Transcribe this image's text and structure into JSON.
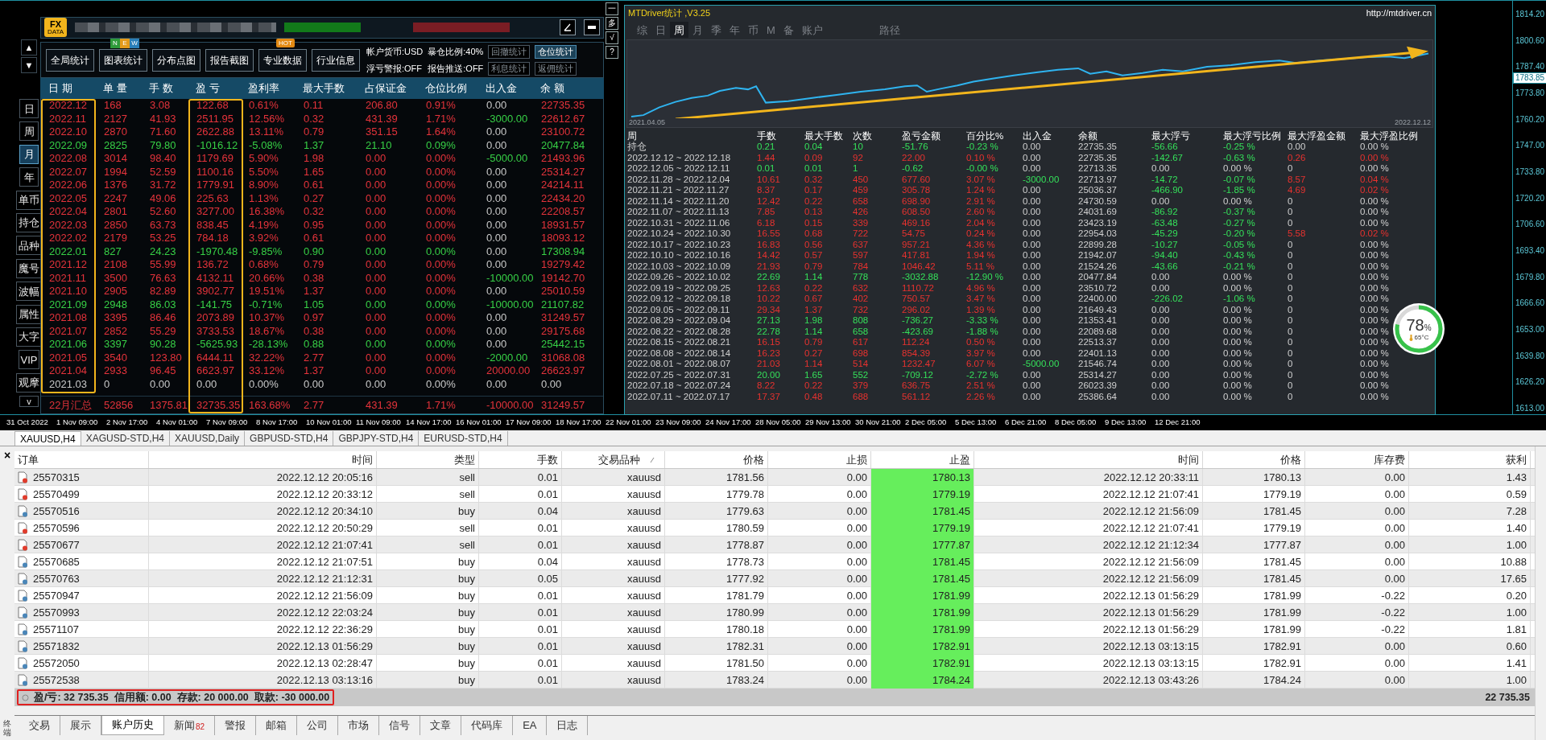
{
  "left_panel": {
    "logo": {
      "top": "FX",
      "bottom": "DATA"
    },
    "nav_arrows": [
      "▲",
      "▼"
    ],
    "side_buttons": [
      {
        "label": "日",
        "selected": false
      },
      {
        "label": "周",
        "selected": false
      },
      {
        "label": "月",
        "selected": true
      },
      {
        "label": "年",
        "selected": false
      },
      {
        "label": "单币",
        "selected": false
      },
      {
        "label": "持仓",
        "selected": false
      },
      {
        "label": "品种",
        "selected": false
      },
      {
        "label": "魔号",
        "selected": false
      },
      {
        "label": "波幅",
        "selected": false
      },
      {
        "label": "属性",
        "selected": false
      },
      {
        "label": "大字",
        "selected": false
      },
      {
        "label": "VIP",
        "selected": false
      },
      {
        "label": "观摩",
        "selected": false
      },
      {
        "label": "v",
        "selected": false
      }
    ],
    "toolbar": [
      {
        "label": "全局统计"
      },
      {
        "label": "图表统计",
        "badge": {
          "kind": "new",
          "letters": [
            "N",
            "E",
            "W"
          ]
        }
      },
      {
        "label": "分布点图"
      },
      {
        "label": "报告截图"
      },
      {
        "label": "专业数据",
        "badge": {
          "kind": "hot",
          "letters": [
            "HOT"
          ]
        }
      },
      {
        "label": "行业信息"
      }
    ],
    "info": [
      "帐户货币:USD",
      "暴仓比例:40%",
      "浮亏警报:OFF",
      "报告推送:OFF"
    ],
    "stat_buttons": [
      {
        "label": "回撤统计",
        "selected": false
      },
      {
        "label": "仓位统计",
        "selected": true
      },
      {
        "label": "利息统计",
        "selected": false
      },
      {
        "label": "返佣统计",
        "selected": false
      }
    ],
    "columns": [
      "日 期",
      "单 量",
      "手 数",
      "盈 亏",
      "盈利率",
      "最大手数",
      "占保证金",
      "仓位比例",
      "出入金",
      "余 额"
    ],
    "rows": [
      {
        "kind": "gain",
        "withdrawal": false,
        "deposit": false,
        "cells": [
          "2022.12",
          "168",
          "3.08",
          "122.68",
          "0.61%",
          "0.11",
          "206.80",
          "0.91%",
          "0.00",
          "22735.35"
        ]
      },
      {
        "kind": "gain",
        "withdrawal": true,
        "deposit": false,
        "cells": [
          "2022.11",
          "2127",
          "41.93",
          "2511.95",
          "12.56%",
          "0.32",
          "431.39",
          "1.71%",
          "-3000.00",
          "22612.67"
        ]
      },
      {
        "kind": "gain",
        "withdrawal": false,
        "deposit": false,
        "cells": [
          "2022.10",
          "2870",
          "71.60",
          "2622.88",
          "13.11%",
          "0.79",
          "351.15",
          "1.64%",
          "0.00",
          "23100.72"
        ]
      },
      {
        "kind": "loss",
        "withdrawal": false,
        "deposit": false,
        "cells": [
          "2022.09",
          "2825",
          "79.80",
          "-1016.12",
          "-5.08%",
          "1.37",
          "21.10",
          "0.09%",
          "0.00",
          "20477.84"
        ]
      },
      {
        "kind": "gain",
        "withdrawal": true,
        "deposit": false,
        "cells": [
          "2022.08",
          "3014",
          "98.40",
          "1179.69",
          "5.90%",
          "1.98",
          "0.00",
          "0.00%",
          "-5000.00",
          "21493.96"
        ]
      },
      {
        "kind": "gain",
        "withdrawal": false,
        "deposit": false,
        "cells": [
          "2022.07",
          "1994",
          "52.59",
          "1100.16",
          "5.50%",
          "1.65",
          "0.00",
          "0.00%",
          "0.00",
          "25314.27"
        ]
      },
      {
        "kind": "gain",
        "withdrawal": false,
        "deposit": false,
        "cells": [
          "2022.06",
          "1376",
          "31.72",
          "1779.91",
          "8.90%",
          "0.61",
          "0.00",
          "0.00%",
          "0.00",
          "24214.11"
        ]
      },
      {
        "kind": "gain",
        "withdrawal": false,
        "deposit": false,
        "cells": [
          "2022.05",
          "2247",
          "49.06",
          "225.63",
          "1.13%",
          "0.27",
          "0.00",
          "0.00%",
          "0.00",
          "22434.20"
        ]
      },
      {
        "kind": "gain",
        "withdrawal": false,
        "deposit": false,
        "cells": [
          "2022.04",
          "2801",
          "52.60",
          "3277.00",
          "16.38%",
          "0.32",
          "0.00",
          "0.00%",
          "0.00",
          "22208.57"
        ]
      },
      {
        "kind": "gain",
        "withdrawal": false,
        "deposit": false,
        "cells": [
          "2022.03",
          "2850",
          "63.73",
          "838.45",
          "4.19%",
          "0.95",
          "0.00",
          "0.00%",
          "0.00",
          "18931.57"
        ]
      },
      {
        "kind": "gain",
        "withdrawal": false,
        "deposit": false,
        "cells": [
          "2022.02",
          "2179",
          "53.25",
          "784.18",
          "3.92%",
          "0.61",
          "0.00",
          "0.00%",
          "0.00",
          "18093.12"
        ]
      },
      {
        "kind": "loss",
        "withdrawal": false,
        "deposit": false,
        "cells": [
          "2022.01",
          "827",
          "24.23",
          "-1970.48",
          "-9.85%",
          "0.90",
          "0.00",
          "0.00%",
          "0.00",
          "17308.94"
        ]
      },
      {
        "kind": "gain",
        "withdrawal": false,
        "deposit": false,
        "cells": [
          "2021.12",
          "2108",
          "55.99",
          "136.72",
          "0.68%",
          "0.79",
          "0.00",
          "0.00%",
          "0.00",
          "19279.42"
        ]
      },
      {
        "kind": "gain",
        "withdrawal": true,
        "deposit": false,
        "cells": [
          "2021.11",
          "3500",
          "76.63",
          "4132.11",
          "20.66%",
          "0.38",
          "0.00",
          "0.00%",
          "-10000.00",
          "19142.70"
        ]
      },
      {
        "kind": "gain",
        "withdrawal": false,
        "deposit": false,
        "cells": [
          "2021.10",
          "2905",
          "82.89",
          "3902.77",
          "19.51%",
          "1.37",
          "0.00",
          "0.00%",
          "0.00",
          "25010.59"
        ]
      },
      {
        "kind": "loss",
        "withdrawal": true,
        "deposit": false,
        "cells": [
          "2021.09",
          "2948",
          "86.03",
          "-141.75",
          "-0.71%",
          "1.05",
          "0.00",
          "0.00%",
          "-10000.00",
          "21107.82"
        ]
      },
      {
        "kind": "gain",
        "withdrawal": false,
        "deposit": false,
        "cells": [
          "2021.08",
          "3395",
          "86.46",
          "2073.89",
          "10.37%",
          "0.97",
          "0.00",
          "0.00%",
          "0.00",
          "31249.57"
        ]
      },
      {
        "kind": "gain",
        "withdrawal": false,
        "deposit": false,
        "cells": [
          "2021.07",
          "2852",
          "55.29",
          "3733.53",
          "18.67%",
          "0.38",
          "0.00",
          "0.00%",
          "0.00",
          "29175.68"
        ]
      },
      {
        "kind": "loss",
        "withdrawal": false,
        "deposit": false,
        "cells": [
          "2021.06",
          "3397",
          "90.28",
          "-5625.93",
          "-28.13%",
          "0.88",
          "0.00",
          "0.00%",
          "0.00",
          "25442.15"
        ]
      },
      {
        "kind": "gain",
        "withdrawal": true,
        "deposit": false,
        "cells": [
          "2021.05",
          "3540",
          "123.80",
          "6444.11",
          "32.22%",
          "2.77",
          "0.00",
          "0.00%",
          "-2000.00",
          "31068.08"
        ]
      },
      {
        "kind": "gain",
        "withdrawal": false,
        "deposit": true,
        "cells": [
          "2021.04",
          "2933",
          "96.45",
          "6623.97",
          "33.12%",
          "1.37",
          "0.00",
          "0.00%",
          "20000.00",
          "26623.97"
        ]
      },
      {
        "kind": "flat",
        "withdrawal": false,
        "deposit": false,
        "cells": [
          "2021.03",
          "0",
          "0.00",
          "0.00",
          "0.00%",
          "0.00",
          "0.00",
          "0.00%",
          "0.00",
          "0.00"
        ]
      }
    ],
    "total": [
      "22月汇总",
      "52856",
      "1375.81",
      "32735.35",
      "163.68%",
      "2.77",
      "431.39",
      "1.71%",
      "-10000.00",
      "31249.57"
    ]
  },
  "side_tools": [
    "一",
    "多",
    "√",
    "?"
  ],
  "stats_window": {
    "title": "MTDriver统计 ,V3.25",
    "url": "http://mtdriver.cn",
    "tabs": [
      {
        "label": "综",
        "selected": false
      },
      {
        "label": "日",
        "selected": false
      },
      {
        "label": "周",
        "selected": true
      },
      {
        "label": "月",
        "selected": false
      },
      {
        "label": "季",
        "selected": false
      },
      {
        "label": "年",
        "selected": false
      },
      {
        "label": "币",
        "selected": false
      },
      {
        "label": "M",
        "selected": false
      },
      {
        "label": "备",
        "selected": false
      },
      {
        "label": "账户",
        "selected": false
      }
    ],
    "path_tab": {
      "label": "路径",
      "selected": false
    },
    "chart": {
      "start": "2021.04.05",
      "end": "2022.12.12"
    },
    "columns": [
      "周",
      "手数",
      "最大手数",
      "次数",
      "盈亏金额",
      "百分比%",
      "出入金",
      "余额",
      "最大浮亏",
      "最大浮亏比例",
      "最大浮盈金额",
      "最大浮盈比例"
    ],
    "rows": [
      {
        "kind": "loss",
        "withdrawal": false,
        "drawdown": true,
        "float_gain": false,
        "cells": [
          "持仓",
          "0.21",
          "0.04",
          "10",
          "-51.76",
          "-0.23 %",
          "0.00",
          "22735.35",
          "-56.66",
          "-0.25 %",
          "0.00",
          "0.00 %"
        ]
      },
      {
        "kind": "gain",
        "withdrawal": false,
        "drawdown": true,
        "float_gain": true,
        "cells": [
          "2022.12.12 ~ 2022.12.18",
          "1.44",
          "0.09",
          "92",
          "22.00",
          "0.10 %",
          "0.00",
          "22735.35",
          "-142.67",
          "-0.63 %",
          "0.26",
          "0.00 %"
        ]
      },
      {
        "kind": "loss",
        "withdrawal": false,
        "drawdown": false,
        "float_gain": false,
        "cells": [
          "2022.12.05 ~ 2022.12.11",
          "0.01",
          "0.01",
          "1",
          "-0.62",
          "-0.00 %",
          "0.00",
          "22713.35",
          "0.00",
          "0.00 %",
          "0",
          "0.00 %"
        ]
      },
      {
        "kind": "gain",
        "withdrawal": true,
        "drawdown": true,
        "float_gain": true,
        "cells": [
          "2022.11.28 ~ 2022.12.04",
          "10.61",
          "0.32",
          "450",
          "677.60",
          "3.07 %",
          "-3000.00",
          "22713.97",
          "-14.72",
          "-0.07 %",
          "8.57",
          "0.04 %"
        ]
      },
      {
        "kind": "gain",
        "withdrawal": false,
        "drawdown": true,
        "float_gain": true,
        "cells": [
          "2022.11.21 ~ 2022.11.27",
          "8.37",
          "0.17",
          "459",
          "305.78",
          "1.24 %",
          "0.00",
          "25036.37",
          "-466.90",
          "-1.85 %",
          "4.69",
          "0.02 %"
        ]
      },
      {
        "kind": "gain",
        "withdrawal": false,
        "drawdown": false,
        "float_gain": false,
        "cells": [
          "2022.11.14 ~ 2022.11.20",
          "12.42",
          "0.22",
          "658",
          "698.90",
          "2.91 %",
          "0.00",
          "24730.59",
          "0.00",
          "0.00 %",
          "0",
          "0.00 %"
        ]
      },
      {
        "kind": "gain",
        "withdrawal": false,
        "drawdown": true,
        "float_gain": false,
        "cells": [
          "2022.11.07 ~ 2022.11.13",
          "7.85",
          "0.13",
          "426",
          "608.50",
          "2.60 %",
          "0.00",
          "24031.69",
          "-86.92",
          "-0.37 %",
          "0",
          "0.00 %"
        ]
      },
      {
        "kind": "gain",
        "withdrawal": false,
        "drawdown": true,
        "float_gain": false,
        "cells": [
          "2022.10.31 ~ 2022.11.06",
          "6.18",
          "0.15",
          "339",
          "469.16",
          "2.04 %",
          "0.00",
          "23423.19",
          "-63.48",
          "-0.27 %",
          "0",
          "0.00 %"
        ]
      },
      {
        "kind": "gain",
        "withdrawal": false,
        "drawdown": true,
        "float_gain": true,
        "cells": [
          "2022.10.24 ~ 2022.10.30",
          "16.55",
          "0.68",
          "722",
          "54.75",
          "0.24 %",
          "0.00",
          "22954.03",
          "-45.29",
          "-0.20 %",
          "5.58",
          "0.02 %"
        ]
      },
      {
        "kind": "gain",
        "withdrawal": false,
        "drawdown": true,
        "float_gain": false,
        "cells": [
          "2022.10.17 ~ 2022.10.23",
          "16.83",
          "0.56",
          "637",
          "957.21",
          "4.36 %",
          "0.00",
          "22899.28",
          "-10.27",
          "-0.05 %",
          "0",
          "0.00 %"
        ]
      },
      {
        "kind": "gain",
        "withdrawal": false,
        "drawdown": true,
        "float_gain": false,
        "cells": [
          "2022.10.10 ~ 2022.10.16",
          "14.42",
          "0.57",
          "597",
          "417.81",
          "1.94 %",
          "0.00",
          "21942.07",
          "-94.40",
          "-0.43 %",
          "0",
          "0.00 %"
        ]
      },
      {
        "kind": "gain",
        "withdrawal": false,
        "drawdown": true,
        "float_gain": false,
        "cells": [
          "2022.10.03 ~ 2022.10.09",
          "21.93",
          "0.79",
          "784",
          "1046.42",
          "5.11 %",
          "0.00",
          "21524.26",
          "-43.66",
          "-0.21 %",
          "0",
          "0.00 %"
        ]
      },
      {
        "kind": "loss",
        "withdrawal": false,
        "drawdown": false,
        "float_gain": false,
        "cells": [
          "2022.09.26 ~ 2022.10.02",
          "22.69",
          "1.14",
          "778",
          "-3032.88",
          "-12.90 %",
          "0.00",
          "20477.84",
          "0.00",
          "0.00 %",
          "0",
          "0.00 %"
        ]
      },
      {
        "kind": "gain",
        "withdrawal": false,
        "drawdown": false,
        "float_gain": false,
        "cells": [
          "2022.09.19 ~ 2022.09.25",
          "12.63",
          "0.22",
          "632",
          "1110.72",
          "4.96 %",
          "0.00",
          "23510.72",
          "0.00",
          "0.00 %",
          "0",
          "0.00 %"
        ]
      },
      {
        "kind": "gain",
        "withdrawal": false,
        "drawdown": true,
        "float_gain": false,
        "cells": [
          "2022.09.12 ~ 2022.09.18",
          "10.22",
          "0.67",
          "402",
          "750.57",
          "3.47 %",
          "0.00",
          "22400.00",
          "-226.02",
          "-1.06 %",
          "0",
          "0.00 %"
        ]
      },
      {
        "kind": "gain",
        "withdrawal": false,
        "drawdown": false,
        "float_gain": false,
        "cells": [
          "2022.09.05 ~ 2022.09.11",
          "29.34",
          "1.37",
          "732",
          "296.02",
          "1.39 %",
          "0.00",
          "21649.43",
          "0.00",
          "0.00 %",
          "0",
          "0.00 %"
        ]
      },
      {
        "kind": "loss",
        "withdrawal": false,
        "drawdown": false,
        "float_gain": false,
        "cells": [
          "2022.08.29 ~ 2022.09.04",
          "27.13",
          "1.98",
          "808",
          "-736.27",
          "-3.33 %",
          "0.00",
          "21353.41",
          "0.00",
          "0.00 %",
          "0",
          "0.00 %"
        ]
      },
      {
        "kind": "loss",
        "withdrawal": false,
        "drawdown": false,
        "float_gain": false,
        "cells": [
          "2022.08.22 ~ 2022.08.28",
          "22.78",
          "1.14",
          "658",
          "-423.69",
          "-1.88 %",
          "0.00",
          "22089.68",
          "0.00",
          "0.00 %",
          "0",
          "0.00 %"
        ]
      },
      {
        "kind": "gain",
        "withdrawal": false,
        "drawdown": false,
        "float_gain": false,
        "cells": [
          "2022.08.15 ~ 2022.08.21",
          "16.15",
          "0.79",
          "617",
          "112.24",
          "0.50 %",
          "0.00",
          "22513.37",
          "0.00",
          "0.00 %",
          "0",
          "0.00 %"
        ]
      },
      {
        "kind": "gain",
        "withdrawal": false,
        "drawdown": false,
        "float_gain": false,
        "cells": [
          "2022.08.08 ~ 2022.08.14",
          "16.23",
          "0.27",
          "698",
          "854.39",
          "3.97 %",
          "0.00",
          "22401.13",
          "0.00",
          "0.00 %",
          "0",
          "0.00 %"
        ]
      },
      {
        "kind": "gain",
        "withdrawal": true,
        "drawdown": false,
        "float_gain": false,
        "cells": [
          "2022.08.01 ~ 2022.08.07",
          "21.03",
          "1.14",
          "514",
          "1232.47",
          "6.07 %",
          "-5000.00",
          "21546.74",
          "0.00",
          "0.00 %",
          "0",
          "0.00 %"
        ]
      },
      {
        "kind": "loss",
        "withdrawal": false,
        "drawdown": false,
        "float_gain": false,
        "cells": [
          "2022.07.25 ~ 2022.07.31",
          "20.00",
          "1.65",
          "552",
          "-709.12",
          "-2.72 %",
          "0.00",
          "25314.27",
          "0.00",
          "0.00 %",
          "0",
          "0.00 %"
        ]
      },
      {
        "kind": "gain",
        "withdrawal": false,
        "drawdown": false,
        "float_gain": false,
        "cells": [
          "2022.07.18 ~ 2022.07.24",
          "8.22",
          "0.22",
          "379",
          "636.75",
          "2.51 %",
          "0.00",
          "26023.39",
          "0.00",
          "0.00 %",
          "0",
          "0.00 %"
        ]
      },
      {
        "kind": "gain",
        "withdrawal": false,
        "drawdown": false,
        "float_gain": false,
        "cells": [
          "2022.07.11 ~ 2022.07.17",
          "17.37",
          "0.48",
          "688",
          "561.12",
          "2.26 %",
          "0.00",
          "25386.64",
          "0.00",
          "0.00 %",
          "0",
          "0.00 %"
        ]
      }
    ]
  },
  "gauge": {
    "value": "78",
    "unit": "%",
    "temperature": "65°C",
    "level": 0.78
  },
  "price_axis": {
    "labels": [
      "1814.20",
      "1800.60",
      "1787.40",
      "1773.80",
      "1760.20",
      "1747.00",
      "1733.80",
      "1720.20",
      "1706.60",
      "1693.40",
      "1679.80",
      "1666.60",
      "1653.00",
      "1639.80",
      "1626.20",
      "1613.00"
    ],
    "current": "1783.85"
  },
  "time_axis": [
    "31 Oct 2022",
    "1 Nov 09:00",
    "2 Nov 17:00",
    "4 Nov 01:00",
    "7 Nov 09:00",
    "8 Nov 17:00",
    "10 Nov 01:00",
    "11 Nov 09:00",
    "14 Nov 17:00",
    "16 Nov 01:00",
    "17 Nov 09:00",
    "18 Nov 17:00",
    "22 Nov 01:00",
    "23 Nov 09:00",
    "24 Nov 17:00",
    "28 Nov 05:00",
    "29 Nov 13:00",
    "30 Nov 21:00",
    "2 Dec 05:00",
    "5 Dec 13:00",
    "6 Dec 21:00",
    "8 Dec 05:00",
    "9 Dec 13:00",
    "12 Dec 21:00"
  ],
  "chart_tabs": [
    {
      "label": "XAUUSD,H4",
      "selected": true
    },
    {
      "label": "XAGUSD-STD,H4",
      "selected": false
    },
    {
      "label": "XAUUSD,Daily",
      "selected": false
    },
    {
      "label": "GBPUSD-STD,H4",
      "selected": false
    },
    {
      "label": "GBPJPY-STD,H4",
      "selected": false
    },
    {
      "label": "EURUSD-STD,H4",
      "selected": false
    }
  ],
  "terminal": {
    "close": "×",
    "side_label": "终端",
    "columns": [
      {
        "label": "订单",
        "sorted": false
      },
      {
        "label": "时间",
        "sorted": false
      },
      {
        "label": "类型",
        "sorted": false
      },
      {
        "label": "手数",
        "sorted": false
      },
      {
        "label": "交易品种",
        "sorted": true
      },
      {
        "label": "价格",
        "sorted": false
      },
      {
        "label": "止损",
        "sorted": false
      },
      {
        "label": "止盈",
        "sorted": false
      },
      {
        "label": "时间",
        "sorted": false
      },
      {
        "label": "价格",
        "sorted": false
      },
      {
        "label": "库存费",
        "sorted": false
      },
      {
        "label": "获利",
        "sorted": false
      }
    ],
    "rows": [
      {
        "kind": "sell",
        "cells": [
          "25570315",
          "2022.12.12 20:05:16",
          "sell",
          "0.01",
          "xauusd",
          "1781.56",
          "0.00",
          "1780.13",
          "2022.12.12 20:33:11",
          "1780.13",
          "0.00",
          "1.43"
        ]
      },
      {
        "kind": "sell",
        "cells": [
          "25570499",
          "2022.12.12 20:33:12",
          "sell",
          "0.01",
          "xauusd",
          "1779.78",
          "0.00",
          "1779.19",
          "2022.12.12 21:07:41",
          "1779.19",
          "0.00",
          "0.59"
        ]
      },
      {
        "kind": "buy",
        "cells": [
          "25570516",
          "2022.12.12 20:34:10",
          "buy",
          "0.04",
          "xauusd",
          "1779.63",
          "0.00",
          "1781.45",
          "2022.12.12 21:56:09",
          "1781.45",
          "0.00",
          "7.28"
        ]
      },
      {
        "kind": "sell",
        "cells": [
          "25570596",
          "2022.12.12 20:50:29",
          "sell",
          "0.01",
          "xauusd",
          "1780.59",
          "0.00",
          "1779.19",
          "2022.12.12 21:07:41",
          "1779.19",
          "0.00",
          "1.40"
        ]
      },
      {
        "kind": "sell",
        "cells": [
          "25570677",
          "2022.12.12 21:07:41",
          "sell",
          "0.01",
          "xauusd",
          "1778.87",
          "0.00",
          "1777.87",
          "2022.12.12 21:12:34",
          "1777.87",
          "0.00",
          "1.00"
        ]
      },
      {
        "kind": "buy",
        "cells": [
          "25570685",
          "2022.12.12 21:07:51",
          "buy",
          "0.04",
          "xauusd",
          "1778.73",
          "0.00",
          "1781.45",
          "2022.12.12 21:56:09",
          "1781.45",
          "0.00",
          "10.88"
        ]
      },
      {
        "kind": "buy",
        "cells": [
          "25570763",
          "2022.12.12 21:12:31",
          "buy",
          "0.05",
          "xauusd",
          "1777.92",
          "0.00",
          "1781.45",
          "2022.12.12 21:56:09",
          "1781.45",
          "0.00",
          "17.65"
        ]
      },
      {
        "kind": "buy",
        "cells": [
          "25570947",
          "2022.12.12 21:56:09",
          "buy",
          "0.01",
          "xauusd",
          "1781.79",
          "0.00",
          "1781.99",
          "2022.12.13 01:56:29",
          "1781.99",
          "-0.22",
          "0.20"
        ]
      },
      {
        "kind": "buy",
        "cells": [
          "25570993",
          "2022.12.12 22:03:24",
          "buy",
          "0.01",
          "xauusd",
          "1780.99",
          "0.00",
          "1781.99",
          "2022.12.13 01:56:29",
          "1781.99",
          "-0.22",
          "1.00"
        ]
      },
      {
        "kind": "buy",
        "cells": [
          "25571107",
          "2022.12.12 22:36:29",
          "buy",
          "0.01",
          "xauusd",
          "1780.18",
          "0.00",
          "1781.99",
          "2022.12.13 01:56:29",
          "1781.99",
          "-0.22",
          "1.81"
        ]
      },
      {
        "kind": "buy",
        "cells": [
          "25571832",
          "2022.12.13 01:56:29",
          "buy",
          "0.01",
          "xauusd",
          "1782.31",
          "0.00",
          "1782.91",
          "2022.12.13 03:13:15",
          "1782.91",
          "0.00",
          "0.60"
        ]
      },
      {
        "kind": "buy",
        "cells": [
          "25572050",
          "2022.12.13 02:28:47",
          "buy",
          "0.01",
          "xauusd",
          "1781.50",
          "0.00",
          "1782.91",
          "2022.12.13 03:13:15",
          "1782.91",
          "0.00",
          "1.41"
        ]
      },
      {
        "kind": "buy",
        "cells": [
          "25572538",
          "2022.12.13 03:13:16",
          "buy",
          "0.01",
          "xauusd",
          "1783.24",
          "0.00",
          "1784.24",
          "2022.12.13 03:43:26",
          "1784.24",
          "0.00",
          "1.00"
        ]
      }
    ],
    "summary": "盈/亏: 32 735.35  信用额: 0.00  存款: 20 000.00  取款: -30 000.00",
    "summary_total": "22 735.35",
    "tabs": [
      {
        "label": "交易",
        "selected": false
      },
      {
        "label": "展示",
        "selected": false
      },
      {
        "label": "账户历史",
        "selected": true
      },
      {
        "label": "新闻",
        "selected": false,
        "badge": "82"
      },
      {
        "label": "警报",
        "selected": false
      },
      {
        "label": "邮箱",
        "selected": false
      },
      {
        "label": "公司",
        "selected": false
      },
      {
        "label": "市场",
        "selected": false
      },
      {
        "label": "信号",
        "selected": false
      },
      {
        "label": "文章",
        "selected": false
      },
      {
        "label": "代码库",
        "selected": false
      },
      {
        "label": "EA",
        "selected": false
      },
      {
        "label": "日志",
        "selected": false
      }
    ]
  }
}
